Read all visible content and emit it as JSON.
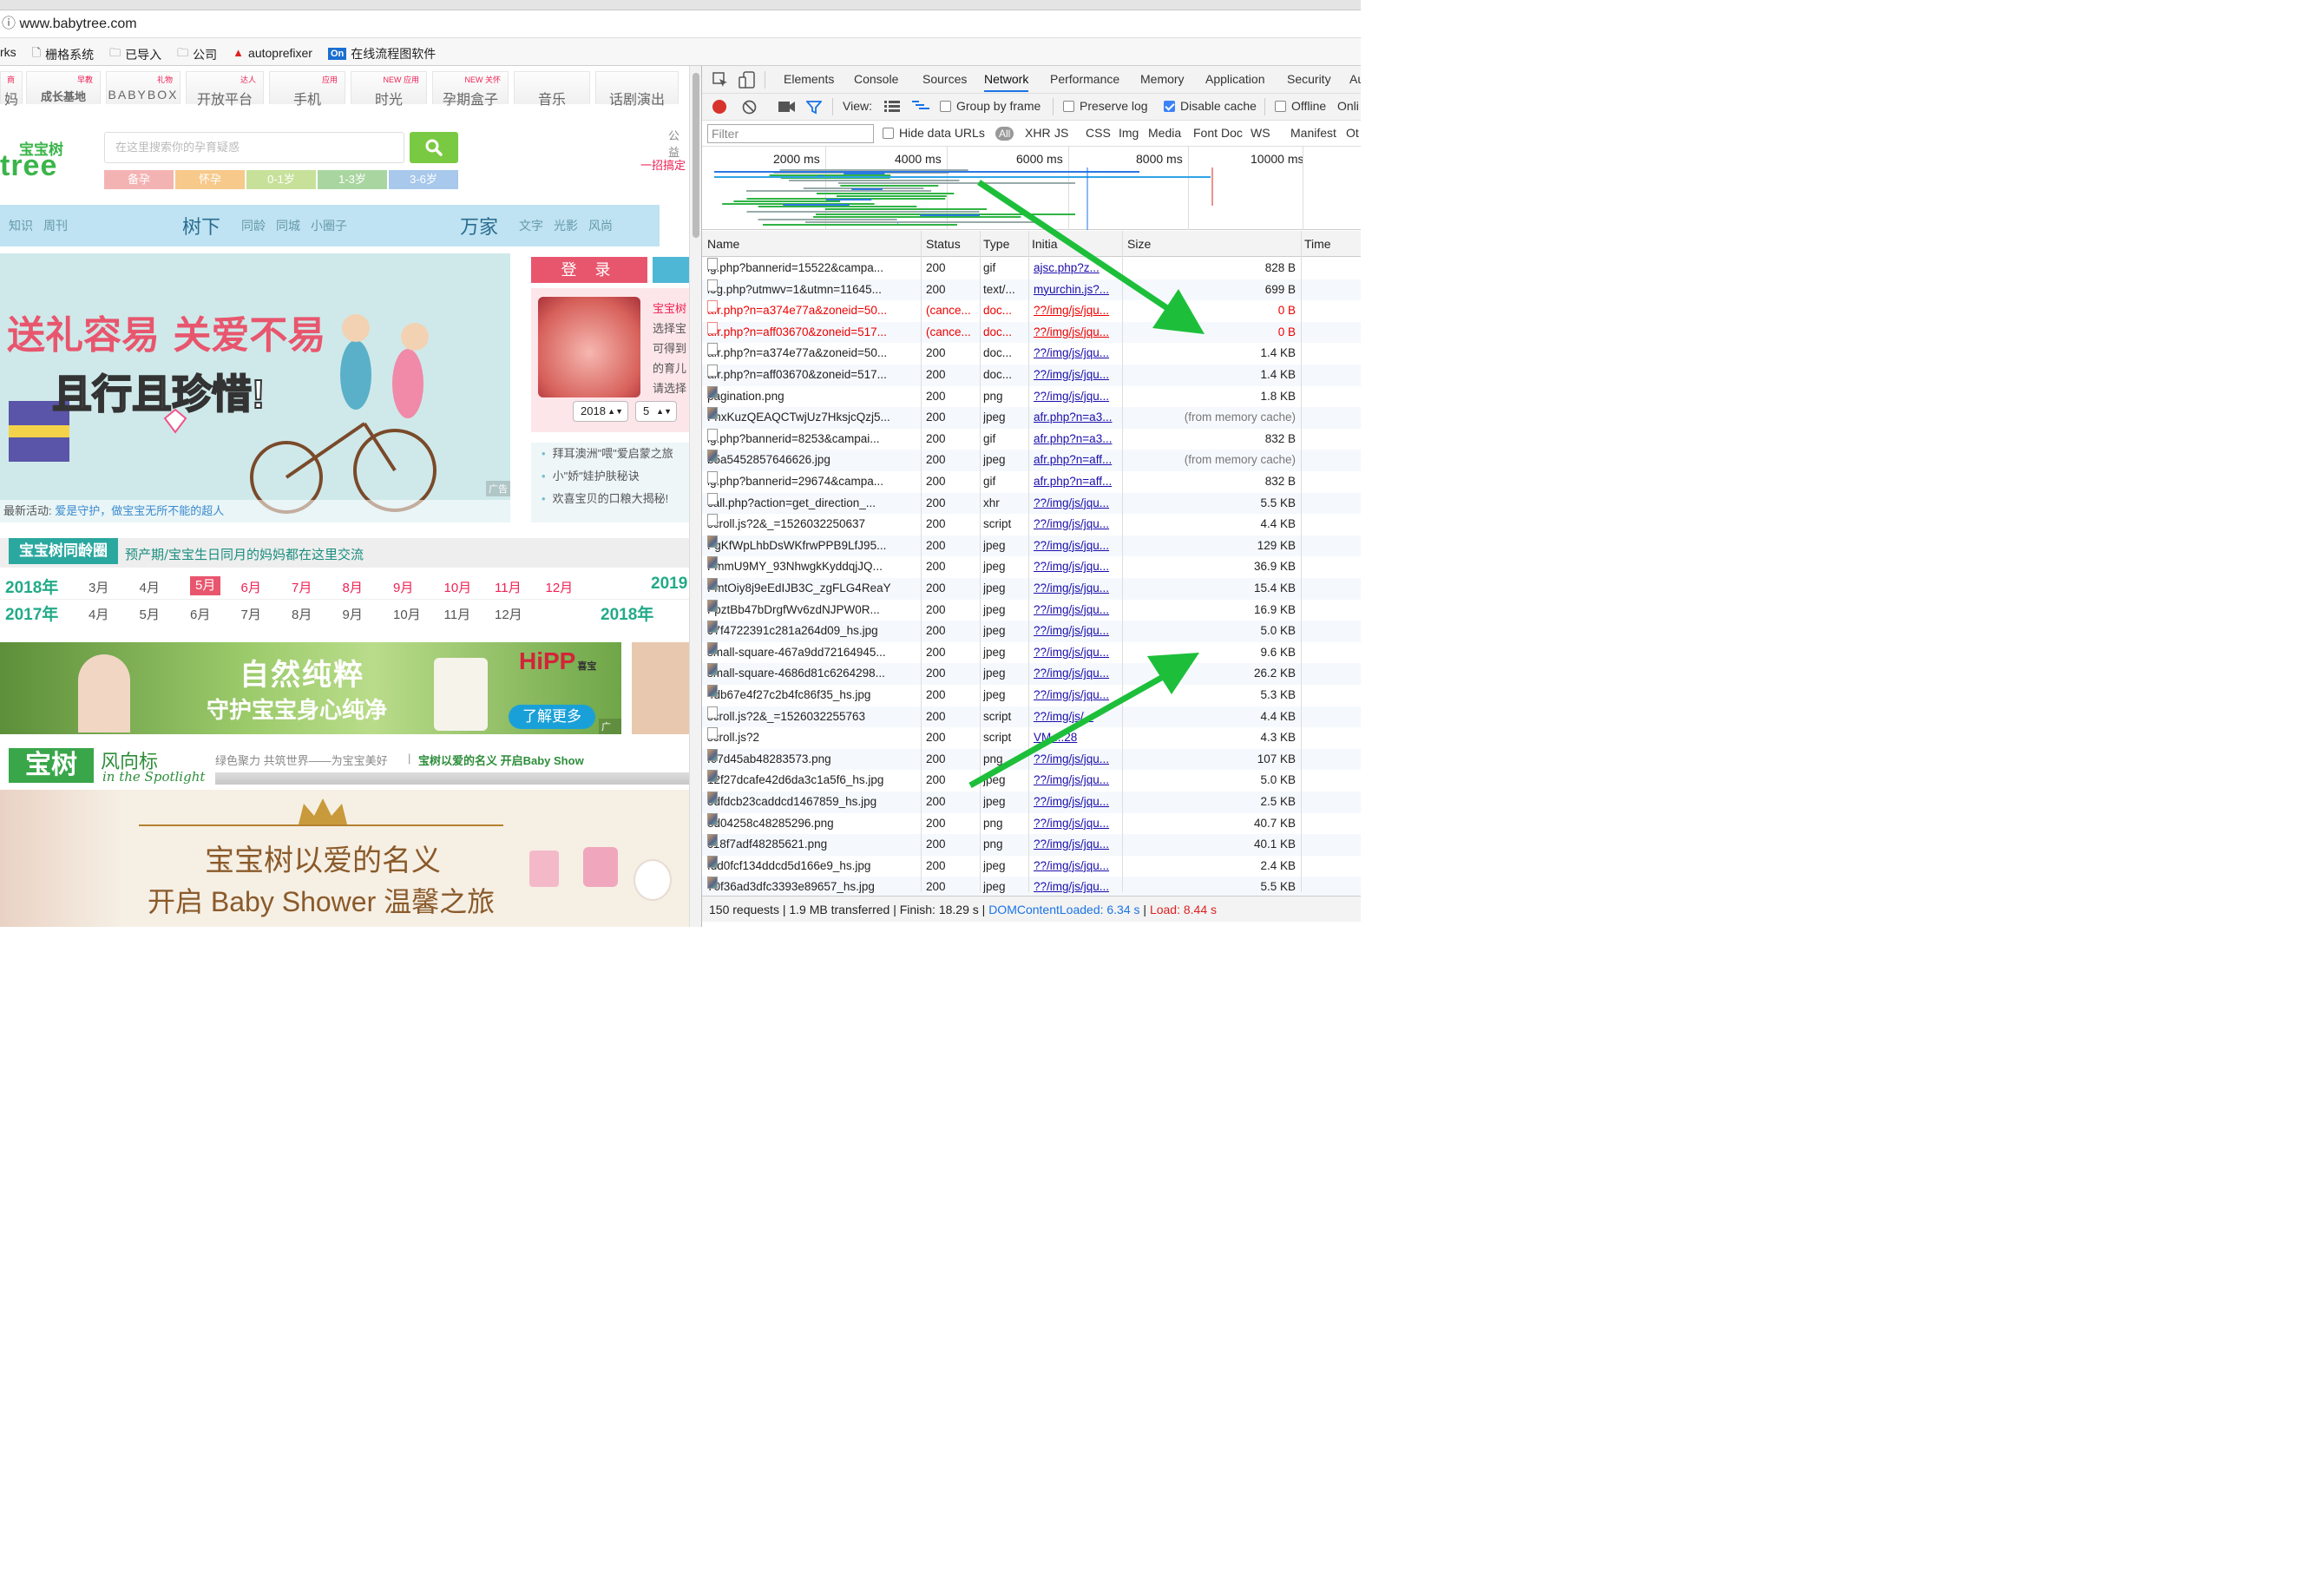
{
  "browser": {
    "url": "www.babytree.com",
    "bookmarks": [
      "rks",
      "栅格系统",
      "已导入",
      "公司",
      "autoprefixer",
      "在线流程图软件"
    ],
    "bookmark_icons": [
      "",
      "page-icon",
      "folder-icon",
      "folder-icon",
      "autoprefixer-icon",
      "on-icon"
    ]
  },
  "site": {
    "nav_tabs": [
      {
        "label": "妈",
        "sup": "商"
      },
      {
        "label": "成长基地",
        "sup": "早教"
      },
      {
        "label": "BABYBOX",
        "sup": "礼物"
      },
      {
        "label": "开放平台",
        "sup": "达人"
      },
      {
        "label": "手机",
        "sup": "应用"
      },
      {
        "label": "时光",
        "sup": "NEW 应用"
      },
      {
        "label": "孕期盒子",
        "sup": "NEW 关怀"
      },
      {
        "label": "音乐",
        "sup": ""
      },
      {
        "label": "话剧演出",
        "sup": ""
      }
    ],
    "logo_cn": "宝宝树",
    "logo_en": "tree",
    "search_placeholder": "在这里搜索你的孕育疑惑",
    "public_text": "公益",
    "slogan": "一招搞定",
    "age_tags": [
      "备孕",
      "怀孕",
      "0-1岁",
      "1-3岁",
      "3-6岁"
    ],
    "age_colors": [
      "#f4b3b3",
      "#f7c98a",
      "#c7e19a",
      "#a9d6a0",
      "#a8c8ec"
    ],
    "blue_nav": [
      "知识",
      "周刊",
      "树下",
      "同龄",
      "同城",
      "小圈子",
      "万家",
      "文字",
      "光影",
      "风尚"
    ],
    "hero_line1": "送礼容易 关爱不易",
    "hero_line2": "且行且珍惜!",
    "hero_ad": "广告",
    "activity_label": "最新活动:",
    "activity_text": "爱是守护，做宝宝无所不能的超人",
    "login": "登 录",
    "pink_text": [
      "宝宝树",
      "选择宝",
      "可得到",
      "的育儿",
      "请选择"
    ],
    "year_select": "2018",
    "month_select": "5",
    "news": [
      "拜耳澳洲\"喂\"爱启蒙之旅",
      "小\"娇\"娃护肤秘诀",
      "欢喜宝贝的口粮大揭秘!"
    ],
    "tong_title": "宝宝树同龄圈",
    "tong_sub": "预产期/宝宝生日同月的妈妈都在这里交流",
    "year1": "2018年",
    "months1": [
      "3月",
      "4月",
      "5月",
      "6月",
      "7月",
      "8月",
      "9月",
      "10月",
      "11月",
      "12月"
    ],
    "year1_end": "2019",
    "year2": "2017年",
    "months2": [
      "4月",
      "5月",
      "6月",
      "7月",
      "8月",
      "9月",
      "10月",
      "11月",
      "12月"
    ],
    "year2_end": "2018年",
    "ad2_line1": "自然纯粹",
    "ad2_line2": "守护宝宝身心纯净",
    "ad2_brand": "HiPP",
    "ad2_brand_cn": "喜宝",
    "ad2_btn": "了解更多",
    "ad2_ad": "广告",
    "fx_title": "宝树",
    "fx_sub": "风向标",
    "fx_en": "in the Spotlight",
    "fx_desc": "绿色聚力 共筑世界——为宝宝美好",
    "fx_link": "宝树以爱的名义 开启Baby Show",
    "bottom_line1": "宝宝树以爱的名义",
    "bottom_line2": "开启 Baby Shower 温馨之旅"
  },
  "devtools": {
    "tabs": [
      "Elements",
      "Console",
      "Sources",
      "Network",
      "Performance",
      "Memory",
      "Application",
      "Security",
      "Au"
    ],
    "active_tab": "Network",
    "toolbar": {
      "view_label": "View:",
      "group_by_frame": "Group by frame",
      "preserve_log": "Preserve log",
      "disable_cache": "Disable cache",
      "offline": "Offline",
      "online": "Onli"
    },
    "filter_placeholder": "Filter",
    "hide_data_urls": "Hide data URLs",
    "filter_types": [
      "All",
      "XHR",
      "JS",
      "CSS",
      "Img",
      "Media",
      "Font",
      "Doc",
      "WS",
      "Manifest",
      "Ot"
    ],
    "timeline_ticks": [
      "2000 ms",
      "4000 ms",
      "6000 ms",
      "8000 ms",
      "10000 ms"
    ],
    "columns": [
      "Name",
      "Status",
      "Type",
      "Initia",
      "Size",
      "Time"
    ],
    "rows": [
      {
        "name": "lg.php?bannerid=15522&campa...",
        "status": "200",
        "type": "gif",
        "init": "ajsc.php?z...",
        "size": "828 B",
        "err": false
      },
      {
        "name": "log.php?utmwv=1&utmn=11645...",
        "status": "200",
        "type": "text/...",
        "init": "myurchin.js?...",
        "size": "699 B",
        "err": false
      },
      {
        "name": "afr.php?n=a374e77a&zoneid=50...",
        "status": "(cance...",
        "type": "doc...",
        "init": "??/img/js/jqu...",
        "size": "0 B",
        "err": true
      },
      {
        "name": "afr.php?n=aff03670&zoneid=517...",
        "status": "(cance...",
        "type": "doc...",
        "init": "??/img/js/jqu...",
        "size": "0 B",
        "err": true
      },
      {
        "name": "afr.php?n=a374e77a&zoneid=50...",
        "status": "200",
        "type": "doc...",
        "init": "??/img/js/jqu...",
        "size": "1.4 KB",
        "err": false
      },
      {
        "name": "afr.php?n=aff03670&zoneid=517...",
        "status": "200",
        "type": "doc...",
        "init": "??/img/js/jqu...",
        "size": "1.4 KB",
        "err": false
      },
      {
        "name": "pagination.png",
        "status": "200",
        "type": "png",
        "init": "??/img/js/jqu...",
        "size": "1.8 KB",
        "err": false
      },
      {
        "name": "FhxKuzQEAQCTwjUz7HksjcQzj5...",
        "status": "200",
        "type": "jpeg",
        "init": "afr.php?n=a3...",
        "size": "(from memory cache)",
        "err": false
      },
      {
        "name": "lg.php?bannerid=8253&campai...",
        "status": "200",
        "type": "gif",
        "init": "afr.php?n=a3...",
        "size": "832 B",
        "err": false
      },
      {
        "name": "b5a5452857646626.jpg",
        "status": "200",
        "type": "jpeg",
        "init": "afr.php?n=aff...",
        "size": "(from memory cache)",
        "err": false
      },
      {
        "name": "lg.php?bannerid=29674&campa...",
        "status": "200",
        "type": "gif",
        "init": "afr.php?n=aff...",
        "size": "832 B",
        "err": false
      },
      {
        "name": "call.php?action=get_direction_...",
        "status": "200",
        "type": "xhr",
        "init": "??/img/js/jqu...",
        "size": "5.5 KB",
        "err": false
      },
      {
        "name": "scroll.js?2&_=1526032250637",
        "status": "200",
        "type": "script",
        "init": "??/img/js/jqu...",
        "size": "4.4 KB",
        "err": false
      },
      {
        "name": "FgKfWpLhbDsWKfrwPPB9LfJ95...",
        "status": "200",
        "type": "jpeg",
        "init": "??/img/js/jqu...",
        "size": "129 KB",
        "err": false
      },
      {
        "name": "FmmU9MY_93NhwgkKyddqjJQ...",
        "status": "200",
        "type": "jpeg",
        "init": "??/img/js/jqu...",
        "size": "36.9 KB",
        "err": false
      },
      {
        "name": "FmtOiy8j9eEdIJB3C_zgFLG4ReaY",
        "status": "200",
        "type": "jpeg",
        "init": "??/img/js/jqu...",
        "size": "15.4 KB",
        "err": false
      },
      {
        "name": "FpztBb47bDrgfWv6zdNJPW0R...",
        "status": "200",
        "type": "jpeg",
        "init": "??/img/js/jqu...",
        "size": "16.9 KB",
        "err": false
      },
      {
        "name": "97f4722391c281a264d09_hs.jpg",
        "status": "200",
        "type": "jpeg",
        "init": "??/img/js/jqu...",
        "size": "5.0 KB",
        "err": false
      },
      {
        "name": "small-square-467a9dd72164945...",
        "status": "200",
        "type": "jpeg",
        "init": "??/img/js/jqu...",
        "size": "9.6 KB",
        "err": false
      },
      {
        "name": "small-square-4686d81c6264298...",
        "status": "200",
        "type": "jpeg",
        "init": "??/img/js/jqu...",
        "size": "26.2 KB",
        "err": false
      },
      {
        "name": "4db67e4f27c2b4fc86f35_hs.jpg",
        "status": "200",
        "type": "jpeg",
        "init": "??/img/js/jqu...",
        "size": "5.3 KB",
        "err": false
      },
      {
        "name": "scroll.js?2&_=1526032255763",
        "status": "200",
        "type": "script",
        "init": "??/img/js/...",
        "size": "4.4 KB",
        "err": false
      },
      {
        "name": "scroll.js?2",
        "status": "200",
        "type": "script",
        "init": "VM...:28",
        "size": "4.3 KB",
        "err": false
      },
      {
        "name": "f07d45ab48283573.png",
        "status": "200",
        "type": "png",
        "init": "??/img/js/jqu...",
        "size": "107 KB",
        "err": false
      },
      {
        "name": "12f27dcafe42d6da3c1a5f6_hs.jpg",
        "status": "200",
        "type": "jpeg",
        "init": "??/img/js/jqu...",
        "size": "5.0 KB",
        "err": false
      },
      {
        "name": "5dfdcb23caddcd1467859_hs.jpg",
        "status": "200",
        "type": "jpeg",
        "init": "??/img/js/jqu...",
        "size": "2.5 KB",
        "err": false
      },
      {
        "name": "8d04258c48285296.png",
        "status": "200",
        "type": "png",
        "init": "??/img/js/jqu...",
        "size": "40.7 KB",
        "err": false
      },
      {
        "name": "c18f7adf48285621.png",
        "status": "200",
        "type": "png",
        "init": "??/img/js/jqu...",
        "size": "40.1 KB",
        "err": false
      },
      {
        "name": "fdd0fcf134ddcd5d166e9_hs.jpg",
        "status": "200",
        "type": "jpeg",
        "init": "??/img/js/jqu...",
        "size": "2.4 KB",
        "err": false
      },
      {
        "name": "70f36ad3dfc3393e89657_hs.jpg",
        "status": "200",
        "type": "jpeg",
        "init": "??/img/js/jqu...",
        "size": "5.5 KB",
        "err": false
      }
    ],
    "status_bar": {
      "summary": "150 requests | 1.9 MB transferred | Finish: 18.29 s |",
      "dom": "DOMContentLoaded: 6.34 s",
      "sep": "|",
      "load": "Load: 8.44 s"
    },
    "colors": {
      "accent": "#1a73e8",
      "error": "#e00000",
      "arrow": "#1dbf3a",
      "dom_line": "#1a73e8",
      "load_line": "#d22"
    }
  }
}
